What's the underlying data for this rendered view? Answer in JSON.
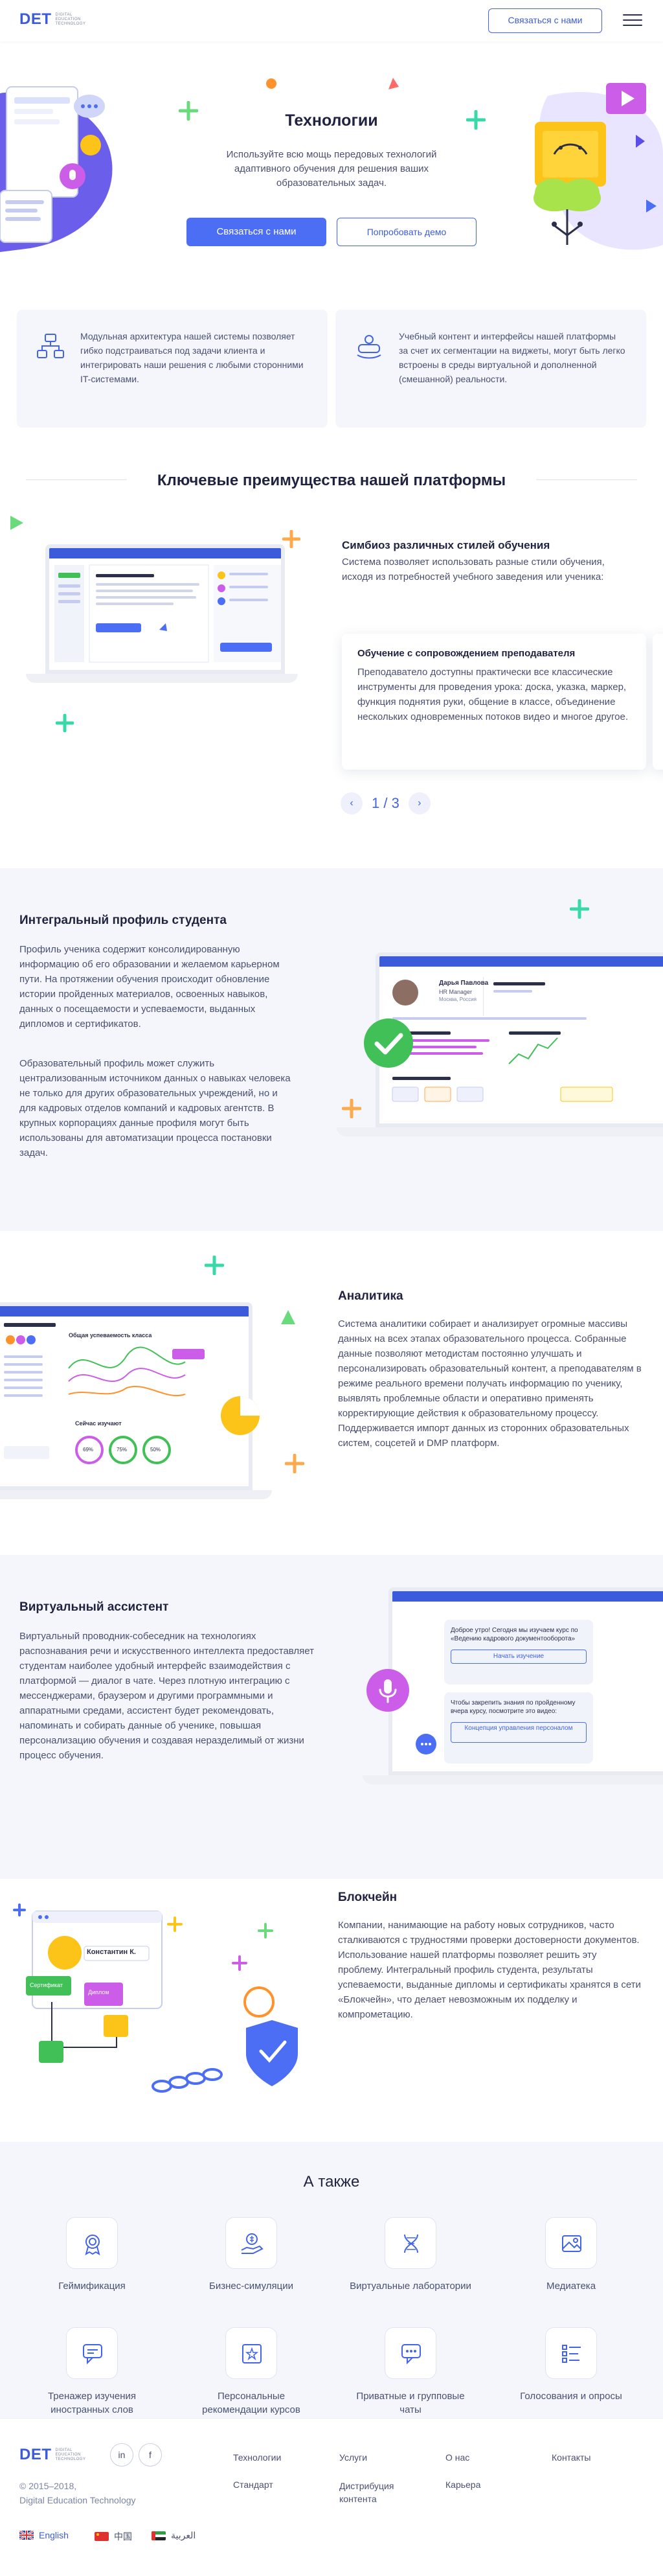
{
  "header": {
    "logo_mark": "DET",
    "logo_sub": [
      "DIGITAL",
      "EDUCATION",
      "TECHNOLOGY"
    ],
    "contact_label": "Связаться с нами"
  },
  "hero": {
    "title": "Технологии",
    "text": "Используйте всю мощь передовых технологий адаптивного обучения для решения ваших образовательных задач.",
    "primary_label": "Связаться с нами",
    "secondary_label": "Попробовать демо"
  },
  "features": [
    {
      "icon": "architecture-icon",
      "text": "Модульная архитектура нашей системы позволяет гибко подстраиваться под задачи клиента и интегрировать наши решения с любыми сторонними IT-системами."
    },
    {
      "icon": "vr-headset-icon",
      "text": "Учебный контент и интерфейсы нашей платформы за счет их сегментации на виджеты, могут быть легко встроены в среды виртуальной и дополненной (смешанной) реальности."
    }
  ],
  "advantages": {
    "title": "Ключевые преимущества нашей платформы",
    "symbiosis_title": "Симбиоз различных стилей обучения",
    "symbiosis_text": "Система позволяет использовать разные стили обучения, исходя из потребностей учебного заведения или ученика:",
    "card_title": "Обучение с сопровождением преподавателя",
    "card_text": "Преподаватело доступны практически все классические инструменты для проведения урока: доска, указка, маркер, функция поднятия руки, общение в классе, объединение нескольких одновременных потоков видео и многое другое.",
    "pager": "1 / 3",
    "prev": "‹",
    "next": "›"
  },
  "profile": {
    "title": "Интегральный профиль студента",
    "p1": "Профиль ученика содержит консолидированную информацию об его образовании и желаемом карьерном пути. На протяжении обучения происходит обновление истории пройденных материалов, освоенных навыков, данных о посещаемости и успеваемости, выданных дипломов и сертификатов.",
    "p2": "Образовательный профиль может служить централизованным источником данных о навыках человека не только для других образовательных учреждений, но и для кадровых отделов компаний и кадровых агентств. В крупных корпорациях данные профиля могут быть использованы для автоматизации процесса постановки задач.",
    "mock_name": "Дарья Павлова",
    "mock_role": "HR Manager",
    "mock_city": "Москва, Россия"
  },
  "analytics": {
    "title": "Аналитика",
    "text": "Система аналитики собирает и анализирует огромные массивы данных на всех этапах образовательного процесса. Собранные данные позволяют методистам постоянно улучшать и персонализировать образовательный контент, а преподавателям в режиме реального времени получать информацию по ученику, выявлять проблемные области и оперативно применять корректирующие действия к образовательному процессу. Поддерживается импорт данных из сторонних образовательных систем, соцсетей и DMP платформ.",
    "mock_chart_title": "Общая успеваемость класса",
    "mock_students_title": "Сейчас изучают",
    "mock_percents": [
      "69%",
      "75%",
      "50%"
    ]
  },
  "assistant": {
    "title": "Виртуальный ассистент",
    "text": "Виртуальный проводник-собеседник на технологиях распознавания речи и искусственного интеллекта предоставляет студентам наиболее удобный интерфейс взаимодействия с платформой — диалог в чате. Через плотную интеграцию с мессенджерами, браузером и другими программными и аппаратными средами, ассистент будет рекомендовать, напоминать и собирать данные об ученике, повышая персонализацию обучения и создавая неразделимый от жизни процесс обучения.",
    "bubble1": "Доброе утро! Сегодня мы изучаем курс по «Ведению кадрового документооборота»",
    "bubble1_btn": "Начать изучение",
    "bubble2": "Чтобы закрепить знания по пройденному вчера курсу, посмотрите это видео:",
    "bubble2_btn": "Концепция управления персоналом"
  },
  "blockchain": {
    "title": "Блокчейн",
    "text": "Компании, нанимающие на работу новых сотрудников, часто сталкиваются с трудностями проверки достоверности документов. Использование нашей платформы позволяет решить эту проблему. Интегральный профиль студента, результаты успеваемости, выданные дипломы и сертификаты хранятся в сети «Блокчейн», что делает невозможным их подделку и компрометацию.",
    "person": "Константин К.",
    "cert1": "Сертификат",
    "cert2": "Диплом"
  },
  "also": {
    "title": "А также",
    "items": [
      {
        "icon": "medal-icon",
        "label": "Геймификация"
      },
      {
        "icon": "business-hand-icon",
        "label": "Бизнес-симуляции"
      },
      {
        "icon": "dna-icon",
        "label": "Виртуальные лаборатории"
      },
      {
        "icon": "gallery-icon",
        "label": "Медиатека"
      },
      {
        "icon": "speech-icon",
        "label": "Тренажер изучения иностранных слов"
      },
      {
        "icon": "recommend-icon",
        "label": "Персональные рекомендации курсов"
      },
      {
        "icon": "chat-icon",
        "label": "Приватные и групповые чаты"
      },
      {
        "icon": "poll-icon",
        "label": "Голосования и опросы"
      }
    ]
  },
  "footer": {
    "copyright": "© 2015–2018,",
    "company": "Digital Education Technology",
    "links": [
      "Технологии",
      "Услуги",
      "О нас",
      "Контакты",
      "Стандарт",
      "Дистрибуция контента",
      "Карьера"
    ],
    "social": [
      "in",
      "f"
    ],
    "languages": [
      "English",
      "中国",
      "العربية"
    ]
  },
  "colors": {
    "accent": "#4c6ef5",
    "band": "#f5f6fb",
    "green": "#40c057",
    "purple": "#cc5de8",
    "yellow": "#fcc419"
  }
}
